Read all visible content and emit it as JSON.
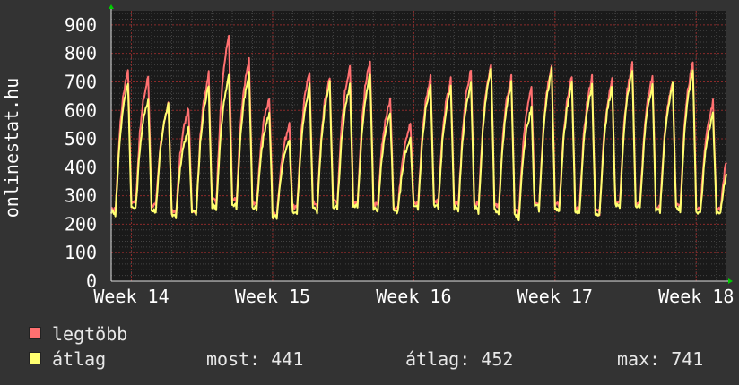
{
  "chart_data": {
    "type": "line",
    "ylabel": "onlinestat.hu",
    "xlabel": "",
    "title": "",
    "ylim": [
      0,
      950
    ],
    "yticks": [
      0,
      100,
      200,
      300,
      400,
      500,
      600,
      700,
      800,
      900
    ],
    "xticks": [
      "Week 14",
      "Week 15",
      "Week 16",
      "Week 17",
      "Week 18"
    ],
    "x_unit": "day",
    "x_range_days": [
      0,
      30.5
    ],
    "xtick_positions_days": [
      1.0,
      8.0,
      15.0,
      22.0,
      29.0
    ],
    "grid": true,
    "legend_position": "bottom-left",
    "series": [
      {
        "name": "legtöbb",
        "color": "#ff7070",
        "daily_peak": [
          750,
          720,
          620,
          610,
          730,
          870,
          780,
          645,
          550,
          740,
          720,
          760,
          780,
          640,
          555,
          720,
          710,
          745,
          770,
          720,
          680,
          765,
          720,
          720,
          710,
          770,
          720,
          705,
          770,
          630,
          510
        ],
        "daily_min": [
          240,
          270,
          260,
          235,
          240,
          275,
          275,
          270,
          230,
          250,
          265,
          275,
          270,
          260,
          255,
          265,
          270,
          265,
          260,
          255,
          235,
          265,
          260,
          245,
          240,
          270,
          265,
          255,
          260,
          250,
          250
        ]
      },
      {
        "name": "átlag",
        "color": "#ffff70",
        "daily_peak": [
          700,
          640,
          620,
          540,
          690,
          720,
          730,
          590,
          495,
          690,
          700,
          690,
          730,
          590,
          500,
          690,
          680,
          700,
          750,
          695,
          610,
          745,
          695,
          690,
          690,
          745,
          695,
          690,
          745,
          590,
          440
        ],
        "daily_min": [
          235,
          250,
          240,
          225,
          235,
          255,
          260,
          250,
          220,
          235,
          245,
          255,
          255,
          245,
          240,
          250,
          255,
          250,
          245,
          240,
          220,
          250,
          245,
          235,
          230,
          255,
          250,
          240,
          245,
          235,
          240
        ]
      }
    ]
  },
  "legend": {
    "items": [
      {
        "label": "legtöbb",
        "color": "#ff7070"
      },
      {
        "label": "átlag",
        "color": "#ffff70"
      }
    ]
  },
  "stats": {
    "most": "most: 441",
    "atlag": "átlag: 452",
    "max": "max: 741"
  },
  "style": {
    "background": "#333333",
    "plot_background": "#1a1a1a",
    "grid_major": "#8a2a2a",
    "axis_color": "#e0e0e0",
    "text_color": "#ffffff"
  }
}
